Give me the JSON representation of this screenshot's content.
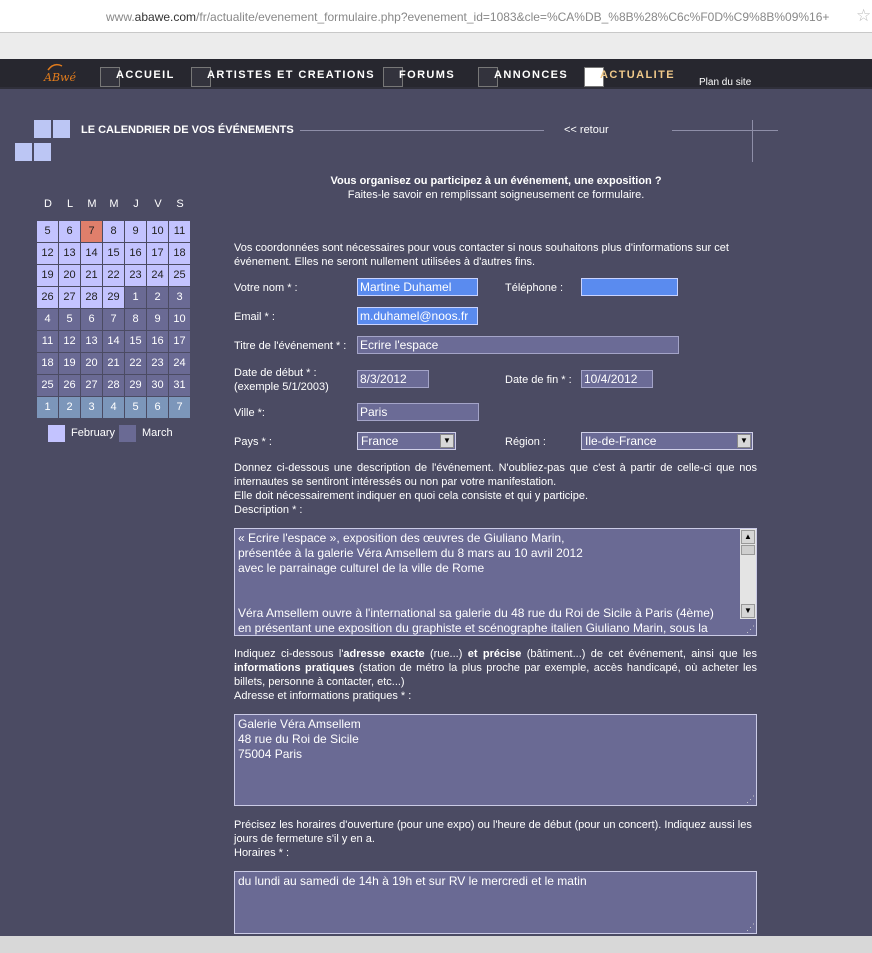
{
  "browser": {
    "url_prefix": "www.",
    "url_domain": "abawe.com",
    "url_rest": "/fr/actualite/evenement_formulaire.php?evenement_id=1083&cle=%CA%DB_%8B%28%C6c%F0D%C9%8B%09%16+"
  },
  "nav": {
    "logo_text": "ABwé",
    "items": [
      {
        "label": "Accueil"
      },
      {
        "label": "Artistes et creations"
      },
      {
        "label": "Forums"
      },
      {
        "label": "Annonces"
      },
      {
        "label": "Actualite"
      }
    ],
    "plan": "Plan du site"
  },
  "calendar": {
    "title": "LE CALENDRIER DE VOS ÉVÉNEMENTS",
    "retour": "<< retour",
    "days": [
      "D",
      "L",
      "M",
      "M",
      "J",
      "V",
      "S"
    ],
    "rows": [
      [
        "5",
        "6",
        "7",
        "8",
        "9",
        "10",
        "11"
      ],
      [
        "12",
        "13",
        "14",
        "15",
        "16",
        "17",
        "18"
      ],
      [
        "19",
        "20",
        "21",
        "22",
        "23",
        "24",
        "25"
      ],
      [
        "26",
        "27",
        "28",
        "29",
        "1",
        "2",
        "3"
      ],
      [
        "4",
        "5",
        "6",
        "7",
        "8",
        "9",
        "10"
      ],
      [
        "11",
        "12",
        "13",
        "14",
        "15",
        "16",
        "17"
      ],
      [
        "18",
        "19",
        "20",
        "21",
        "22",
        "23",
        "24"
      ],
      [
        "25",
        "26",
        "27",
        "28",
        "29",
        "30",
        "31"
      ],
      [
        "1",
        "2",
        "3",
        "4",
        "5",
        "6",
        "7"
      ]
    ],
    "legend_feb": "February",
    "legend_mar": "March",
    "colors": {
      "feb": "#c3c3ff",
      "mar": "#6a6a94",
      "today": "#e07f6b",
      "next": "#7c96ba"
    }
  },
  "form": {
    "heading": "Vous organisez ou participez à un événement, une exposition ?",
    "subheading": "Faites-le savoir en remplissant soigneusement ce formulaire.",
    "intro": "Vos coordonnées sont nécessaires pour vous contacter si nous souhaitons plus d'informations sur cet événement. Elles ne seront nullement utilisées à d'autres fins.",
    "nom_label": "Votre nom * :",
    "nom_value": "Martine Duhamel",
    "tel_label": "Téléphone :",
    "tel_value": "",
    "email_label": "Email * :",
    "email_value": "m.duhamel@noos.fr",
    "titre_label": "Titre de l'événement * :",
    "titre_value": "Ecrire l'espace",
    "debut_label": "Date de début * :",
    "debut_example": "(exemple 5/1/2003)",
    "debut_value": "8/3/2012",
    "fin_label": "Date de fin * :",
    "fin_value": "10/4/2012",
    "ville_label": "Ville *:",
    "ville_value": "Paris",
    "pays_label": "Pays * :",
    "pays_value": "France",
    "region_label": "Région :",
    "region_value": "Ile-de-France",
    "desc_help_1": "Donnez ci-dessous une description de l'événement. N'oubliez-pas que c'est à partir de celle-ci que nos internautes se sentiront intéressés ou non par votre manifestation.",
    "desc_help_2": "Elle doit nécessairement indiquer en quoi cela consiste et qui y participe.",
    "desc_label": "Description * :",
    "desc_lines": [
      "« Ecrire l'espace », exposition des œuvres de Giuliano Marin,",
      "présentée à la galerie Véra Amsellem du 8 mars au 10 avril 2012",
      "avec le parrainage culturel de la ville de Rome",
      "",
      "",
      "Véra Amsellem ouvre à l'international sa galerie du 48 rue du Roi de Sicile à Paris (4ème)",
      "en présentant une exposition du graphiste et scénographe italien Giuliano Marin, sous la"
    ],
    "addr_help_a": "Indiquez ci-dessous l'",
    "addr_help_b": "adresse exacte",
    "addr_help_c": " (rue...) ",
    "addr_help_d": "et précise",
    "addr_help_e": " (bâtiment...) de cet événement, ainsi que les ",
    "addr_help_f": "informations pratiques",
    "addr_help_g": " (station de métro la plus proche par exemple, accès handicapé, où acheter les billets, personne à contacter, etc...)",
    "addr_label": "Adresse et informations pratiques * :",
    "addr_lines": [
      "Galerie Véra Amsellem",
      "48 rue du Roi de Sicile",
      "75004 Paris"
    ],
    "hours_help": "Précisez les horaires d'ouverture (pour une expo) ou l'heure de début (pour un concert). Indiquez aussi les jours de fermeture s'il y en a.",
    "hours_label": "Horaires * :",
    "hours_value": "du lundi au samedi de 14h à 19h et sur RV le mercredi et le matin"
  }
}
